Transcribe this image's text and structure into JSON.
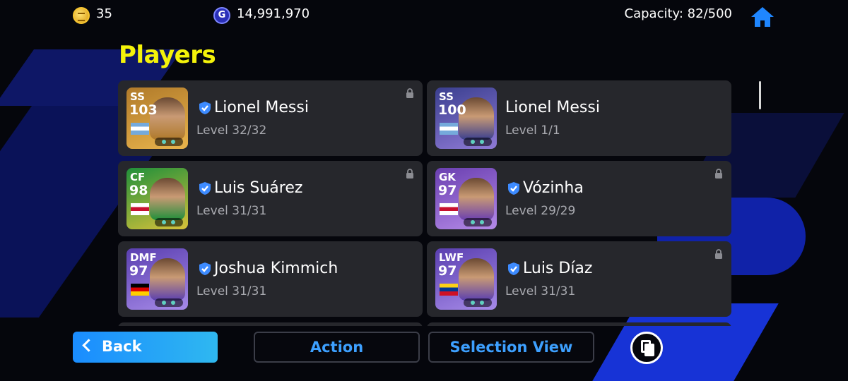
{
  "topbar": {
    "coins_icon": "efootball-coin-icon",
    "coins": "35",
    "gp_icon": "gp-icon",
    "gp_symbol": "G",
    "gp": "14,991,970",
    "capacity": "Capacity: 82/500",
    "home_icon": "home-icon"
  },
  "page": {
    "title": "Players"
  },
  "players": [
    {
      "position": "SS",
      "rating": "103",
      "name": "Lionel Messi",
      "level": "Level 32/32",
      "verified": true,
      "locked": true,
      "card_colors": [
        "#b07a2a",
        "#e9b44c"
      ],
      "flag_colors": [
        "#75aadb",
        "#ffffff",
        "#75aadb"
      ]
    },
    {
      "position": "SS",
      "rating": "100",
      "name": "Lionel Messi",
      "level": "Level 1/1",
      "verified": false,
      "locked": false,
      "card_colors": [
        "#3a3f8f",
        "#8f7ad6"
      ],
      "flag_colors": [
        "#75aadb",
        "#ffffff",
        "#75aadb"
      ]
    },
    {
      "position": "CF",
      "rating": "98",
      "name": "Luis Suárez",
      "level": "Level 31/31",
      "verified": true,
      "locked": true,
      "card_colors": [
        "#1f8f3a",
        "#d7c23a"
      ],
      "flag_colors": [
        "#ffffff",
        "#c8102e",
        "#ffffff"
      ]
    },
    {
      "position": "GK",
      "rating": "97",
      "name": "Vózinha",
      "level": "Level 29/29",
      "verified": true,
      "locked": true,
      "card_colors": [
        "#6a3fb0",
        "#b48ae8"
      ],
      "flag_colors": [
        "#ffffff",
        "#c8102e",
        "#ffffff"
      ]
    },
    {
      "position": "DMF",
      "rating": "97",
      "name": "Joshua Kimmich",
      "level": "Level 31/31",
      "verified": true,
      "locked": false,
      "card_colors": [
        "#5a3fb0",
        "#a68ae8"
      ],
      "flag_colors": [
        "#000000",
        "#dd0000",
        "#ffce00"
      ]
    },
    {
      "position": "LWF",
      "rating": "97",
      "name": "Luis Díaz",
      "level": "Level 31/31",
      "verified": true,
      "locked": true,
      "card_colors": [
        "#5a3fb0",
        "#a68ae8"
      ],
      "flag_colors": [
        "#fcd116",
        "#003893",
        "#ce1126"
      ]
    }
  ],
  "bottom": {
    "back_label": "Back",
    "action_label": "Action",
    "selection_view_label": "Selection View",
    "copy_icon": "copy-icon"
  },
  "colors": {
    "accent_yellow": "#f4f20a",
    "accent_blue": "#3da0ff",
    "card_bg": "#26272c",
    "verified_blue": "#3d8bff"
  }
}
